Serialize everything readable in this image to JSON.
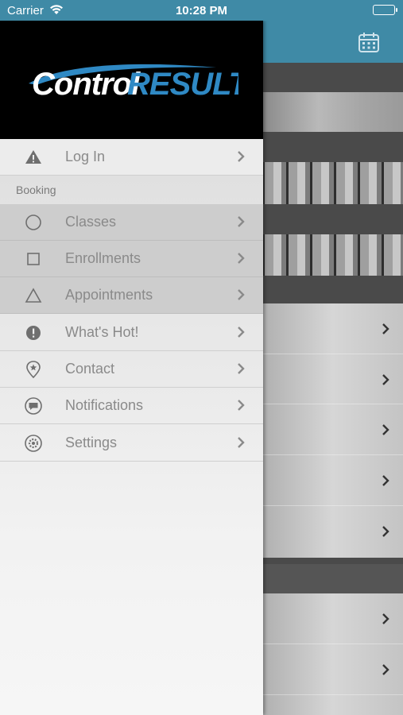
{
  "status_bar": {
    "carrier": "Carrier",
    "time": "10:28 PM"
  },
  "app": {
    "brand_name": "ControlRESULTS",
    "brand_colors": {
      "accent": "#3f8aa6",
      "logo_blue": "#2f89c4"
    }
  },
  "menu": {
    "login": {
      "label": "Log In",
      "icon": "warning-icon"
    },
    "section_booking": "Booking",
    "items": [
      {
        "label": "Classes",
        "icon": "circle-icon"
      },
      {
        "label": "Enrollments",
        "icon": "square-icon"
      },
      {
        "label": "Appointments",
        "icon": "triangle-icon"
      },
      {
        "label": "What's Hot!",
        "icon": "alert-circle-icon"
      },
      {
        "label": "Contact",
        "icon": "location-pin-icon"
      },
      {
        "label": "Notifications",
        "icon": "message-bubble-icon"
      },
      {
        "label": "Settings",
        "icon": "gear-icon"
      }
    ]
  },
  "background_view": {
    "header_icon": "calendar-icon"
  }
}
